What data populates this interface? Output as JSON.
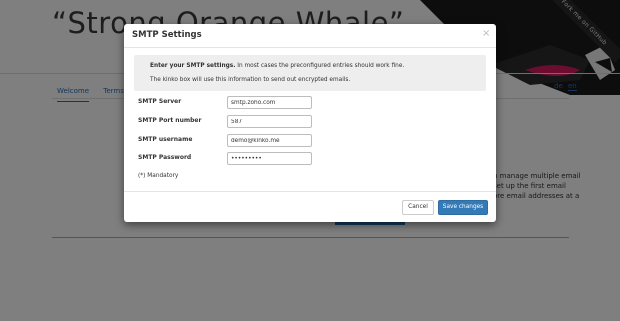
{
  "background": {
    "page_title": "“Strong Orange Whale”",
    "nav": {
      "items": [
        {
          "label": "Welcome"
        },
        {
          "label": "Terms"
        }
      ]
    },
    "languages": [
      {
        "label": "de"
      },
      {
        "label": "en"
      }
    ],
    "ribbon_text": "Fork me on GitHub",
    "body_text_lines": [
      "n manage multiple email",
      "set up the first email",
      "ore email addresses at a"
    ]
  },
  "modal": {
    "title": "SMTP Settings",
    "close_symbol": "×",
    "info": {
      "line1_bold": "Enter your SMTP settings.",
      "line1_rest": " In most cases the preconfigured entries should work fine.",
      "line2": "The kinko box will use this information to send out encrypted emails."
    },
    "fields": [
      {
        "label": "SMTP Server",
        "value": "smtp.zoho.com",
        "type": "text"
      },
      {
        "label": "SMTP Port number",
        "value": "587",
        "type": "text"
      },
      {
        "label": "SMTP username",
        "value": "demo@kinko.me",
        "type": "text"
      },
      {
        "label": "SMTP Password",
        "value": "•••••••••",
        "type": "password"
      }
    ],
    "mandatory_note": "(*) Mandatory",
    "buttons": {
      "cancel": "Cancel",
      "save": "Save changes"
    }
  },
  "colors": {
    "primary": "#337ab7",
    "overlay": "rgba(0,0,0,0.5)",
    "link": "#2a6ebb"
  }
}
